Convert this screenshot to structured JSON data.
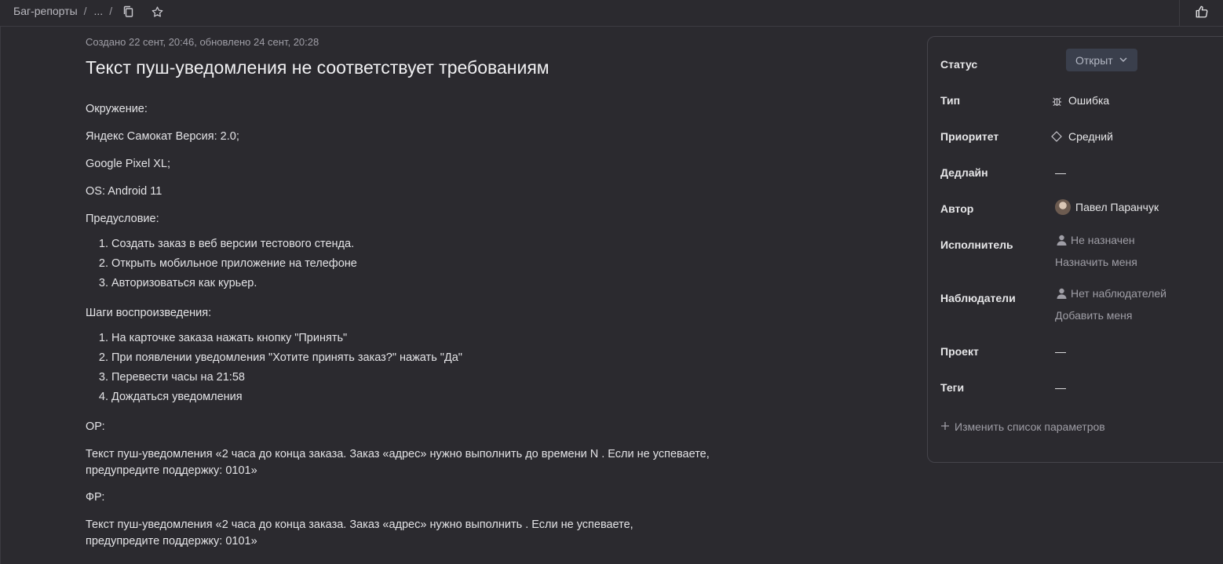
{
  "breadcrumb": {
    "root": "Баг-репорты",
    "sep": "/",
    "ellipsis": "...",
    "sep2": "/"
  },
  "toolbar": {
    "copy_icon": "copy-icon",
    "star_icon": "star-icon",
    "like_icon": "thumbs-up-icon"
  },
  "issue": {
    "meta": "Создано 22 сент, 20:46, обновлено 24 сент, 20:28",
    "title": "Текст пуш-уведомления не соответствует требованиям",
    "env_label": "Окружение:",
    "env_app": "Яндекс Самокат Версия: 2.0;",
    "env_device": "Google Pixel XL;",
    "env_os": "OS: Android 11",
    "pre_label": "Предусловие:",
    "pre_steps": [
      "Создать заказ в веб версии тестового стенда.",
      "Открыть мобильное приложение на телефоне",
      "Авторизоваться как курьер."
    ],
    "steps_label": "Шаги воспроизведения:",
    "steps": [
      "На карточке заказа нажать кнопку \"Принять\"",
      "При появлении уведомления \"Хотите принять заказ?\" нажать \"Да\"",
      "Перевести часы на 21:58",
      "Дождаться уведомления"
    ],
    "expected_label": "ОР:",
    "expected": "Текст пуш-уведомления «2 часа до конца заказа. Заказ «адрес» нужно выполнить до времени N . Если не успеваете, предупредите поддержку: 0101»",
    "actual_label": "ФР:",
    "actual": "Текст пуш-уведомления «2 часа до конца заказа. Заказ «адрес» нужно выполнить . Если не успеваете, предупредите поддержку: 0101»"
  },
  "panel": {
    "status_label": "Статус",
    "status_value": "Открыт",
    "type_label": "Тип",
    "type_value": "Ошибка",
    "priority_label": "Приоритет",
    "priority_value": "Средний",
    "deadline_label": "Дедлайн",
    "deadline_value": "—",
    "author_label": "Автор",
    "author_value": "Павел Паранчук",
    "assignee_label": "Исполнитель",
    "assignee_value": "Не назначен",
    "assign_me": "Назначить меня",
    "watchers_label": "Наблюдатели",
    "watchers_value": "Нет наблюдателей",
    "add_me": "Добавить меня",
    "project_label": "Проект",
    "project_value": "—",
    "tags_label": "Теги",
    "tags_value": "—",
    "edit_params": "Изменить список параметров"
  }
}
